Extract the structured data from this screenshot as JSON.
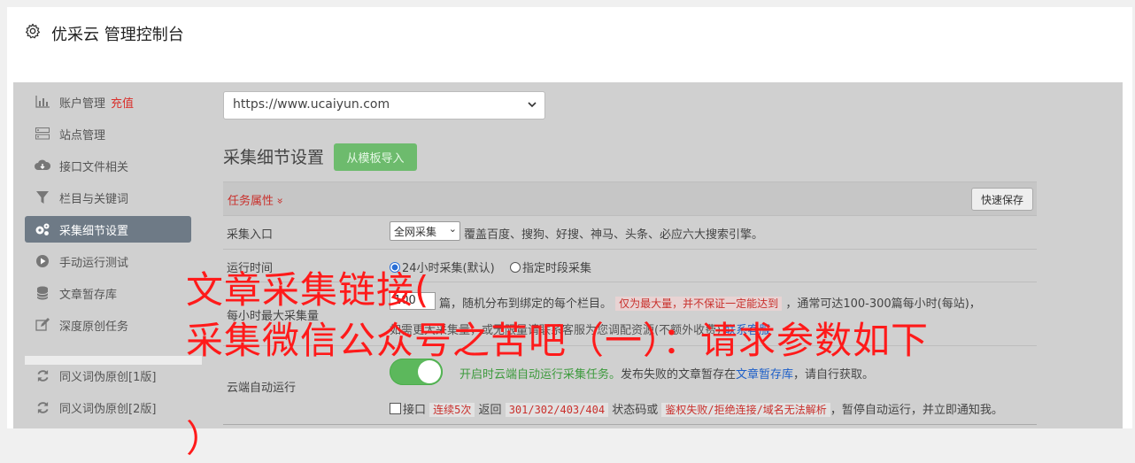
{
  "header": {
    "title": "优采云 管理控制台",
    "icon": "gear-icon"
  },
  "sidebar": {
    "items": [
      {
        "label": "账户管理",
        "extra": "充值",
        "icon": "bar-chart-icon"
      },
      {
        "label": "站点管理",
        "icon": "server-icon"
      },
      {
        "label": "接口文件相关",
        "icon": "cloud-download-icon"
      },
      {
        "label": "栏目与关键词",
        "icon": "filter-icon"
      },
      {
        "label": "采集细节设置",
        "icon": "cogs-icon",
        "active": true
      },
      {
        "label": "手动运行测试",
        "icon": "play-circle-icon"
      },
      {
        "label": "文章暂存库",
        "icon": "database-icon"
      },
      {
        "label": "深度原创任务",
        "icon": "edit-icon"
      },
      {
        "label": "同义词伪原创[1版]",
        "icon": "refresh-icon"
      },
      {
        "label": "同义词伪原创[2版]",
        "icon": "refresh-icon"
      }
    ]
  },
  "main": {
    "site_select": "https://www.ucaiyun.com",
    "section_title": "采集细节设置",
    "import_button": "从模板导入",
    "task_attr": "任务属性",
    "task_attr_chevron": "»",
    "save_button": "快速保存",
    "entry_label": "采集入口",
    "entry_select": "全网采集",
    "entry_desc": "覆盖百度、搜狗、好搜、神马、头条、必应六大搜索引擎。",
    "time_label": "运行时间",
    "radio_1": "24小时采集(默认)",
    "radio_2": "指定时段采集",
    "max_label": "每小时最大采集量",
    "max_value": "100",
    "max_desc_a": "篇，随机分布到绑定的每个栏目。",
    "max_desc_hl": "仅为最大量，并不保证一定能达到",
    "max_desc_b": "，通常可达100-300篇每小时(每站)，",
    "max_desc_line2": "如需更大采集量，或无限量请联系客服为您调配资源(不额外收费)",
    "max_desc_link": "联系客服",
    "cloud_label": "云端自动运行",
    "cloud_desc_green": "开启时云端自动运行采集任务。",
    "cloud_desc_a": "发布失败的文章暂存在",
    "cloud_desc_link": "文章暂存库",
    "cloud_desc_b": "，请自行获取。",
    "chk_a": "接口",
    "chk_hl1": "连续5次",
    "chk_b": "返回",
    "chk_hl2": "301/302/403/404",
    "chk_c": "状态码或",
    "chk_hl3": "鉴权失败/拒绝连接/域名无法解析",
    "chk_d": "，暂停自动运行，并立即通知我。"
  },
  "watermark": {
    "line1": "文章采集链接(",
    "line2": "采集微信公众号之苦吧（一）：请求参数如下",
    "line3": "）"
  },
  "colors": {
    "accent_green": "#5cb85c",
    "active_sidebar": "#6e7a86",
    "watermark_red": "#ff1a1a"
  }
}
